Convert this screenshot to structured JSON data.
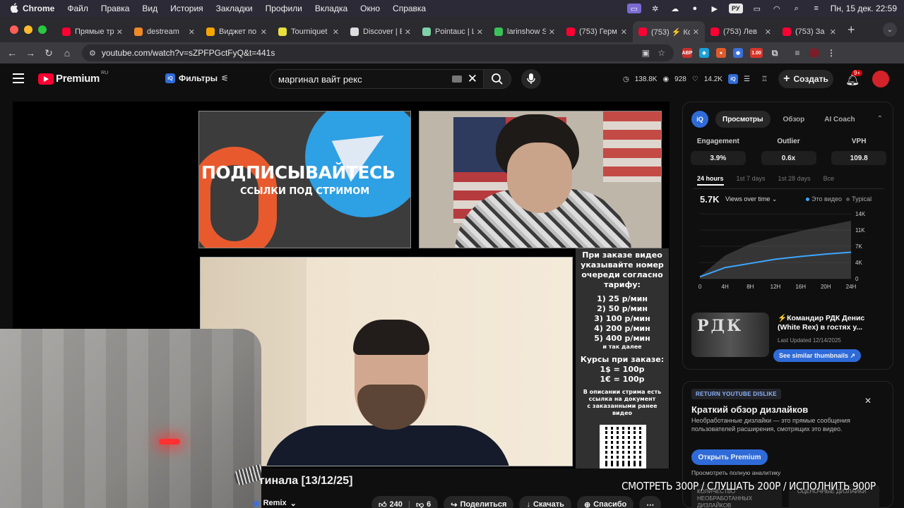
{
  "menubar": {
    "app": "Chrome",
    "items": [
      "Файл",
      "Правка",
      "Вид",
      "История",
      "Закладки",
      "Профили",
      "Вкладка",
      "Окно",
      "Справка"
    ],
    "clock": "Пн, 15 дек. 22:59",
    "lang": "РУ"
  },
  "tabs": [
    {
      "title": "Прямые тр",
      "color": "#ff0033"
    },
    {
      "title": "destream",
      "color": "#f08a24"
    },
    {
      "title": "Виджет по",
      "color": "#f7a600"
    },
    {
      "title": "Tourniquet",
      "color": "#e8e03b"
    },
    {
      "title": "Discover | E",
      "color": "#dddddd"
    },
    {
      "title": "Pointauc | L",
      "color": "#7fd1a8"
    },
    {
      "title": "larinshow S",
      "color": "#3ac25a"
    },
    {
      "title": "(753) Герм",
      "color": "#ff0033"
    },
    {
      "title": "(753) ⚡ Ко",
      "color": "#ff0033"
    },
    {
      "title": "(753) Лев",
      "color": "#ff0033"
    },
    {
      "title": "(753) За",
      "color": "#ff0033"
    }
  ],
  "address": {
    "url": "youtube.com/watch?v=sZPFPGctFyQ&t=441s"
  },
  "extensions": {
    "abp": "ABP",
    "badge": "1.00"
  },
  "yt": {
    "logo": "Premium",
    "region": "RU",
    "filters": "Фильтры",
    "iq": "iQ",
    "search_value": "маргинал вайт рекс",
    "stats": {
      "views": "138.8K",
      "watching": "928",
      "likes": "14.2K"
    },
    "create": "Создать",
    "notif": "9+"
  },
  "video": {
    "promo_title": "ПОДПИСЫВАЙТЕСЬ",
    "promo_sub": "ССЫЛКИ ПОД СТРИМОМ",
    "price_lines": [
      "При заказе видео",
      "указывайте номер",
      "очереди согласно",
      "тарифу:"
    ],
    "prices": [
      "1) 25 р/мин",
      "2) 50 р/мин",
      "3) 100 р/мин",
      "4) 200 р/мин",
      "5) 400 р/мин"
    ],
    "prices_more": "и так далее",
    "courses_title": "Курсы при заказе:",
    "courses": [
      "1$ = 100р",
      "1€ = 100р"
    ],
    "note": [
      "В описании стрима есть",
      "ссылка на документ",
      "с заказанными ранее",
      "видео"
    ],
    "title": "гинала [13/12/25]",
    "remix": "Remix",
    "likes": "240",
    "dislikes": "6",
    "share": "Поделиться",
    "download": "Скачать",
    "thanks": "Спасибо",
    "caption_overlay": "СМОТРЕТЬ 300Р / СЛУШАТЬ 200Р / ИСПОЛНИТЬ 900Р"
  },
  "vidiq": {
    "logo": "iQ",
    "tabs": [
      "Просмотры",
      "Обзор",
      "AI Coach"
    ],
    "metrics": [
      {
        "label": "Engagement",
        "value": "3.9%"
      },
      {
        "label": "Outlier",
        "value": "0.6x"
      },
      {
        "label": "VPH",
        "value": "109.8"
      }
    ],
    "periods": [
      "24 hours",
      "1st 7 days",
      "1st 28 days",
      "Все"
    ],
    "views": "5.7K",
    "views_over_time": "Views over time",
    "legend_this": "Это видео",
    "legend_typical": "Typical",
    "this_color": "#3ea6ff",
    "typical_color": "#555555",
    "chart_data": {
      "type": "area",
      "x": [
        "0",
        "4H",
        "8H",
        "12H",
        "16H",
        "20H",
        "24H"
      ],
      "y_ticks": [
        "14K",
        "11K",
        "7K",
        "4K",
        "0"
      ],
      "ylim": [
        0,
        14000
      ],
      "series": [
        {
          "name": "Это видео",
          "values": [
            400,
            2400,
            3300,
            4200,
            4800,
            5300,
            5700
          ]
        },
        {
          "name": "Typical",
          "values": [
            500,
            5000,
            7500,
            9000,
            10300,
            11400,
            12500
          ]
        }
      ]
    },
    "thumb_letters": "РДК",
    "similar_title": "⚡Командир РДК Денис (White Rex) в гостях у...",
    "similar_updated": "Last Updated 12/14/2025",
    "similar_button": "See similar thumbnails ↗"
  },
  "dislike": {
    "tag": "RETURN YOUTUBE DISLIKE",
    "title": "Краткий обзор дизлайков",
    "body": "Необработанные дизлайки — это прямые сообщения пользователей расширения, смотрящих это видео.",
    "button": "Открыть Premium",
    "link": "Просмотреть полную аналитику",
    "card1": "КОЛИЧЕСТВО НЕОБРАБОТАННЫХ ДИЗЛАЙКОВ",
    "card2": "ОЦЕНОЧНЫЕ ДИЗЛАЙКИ"
  }
}
